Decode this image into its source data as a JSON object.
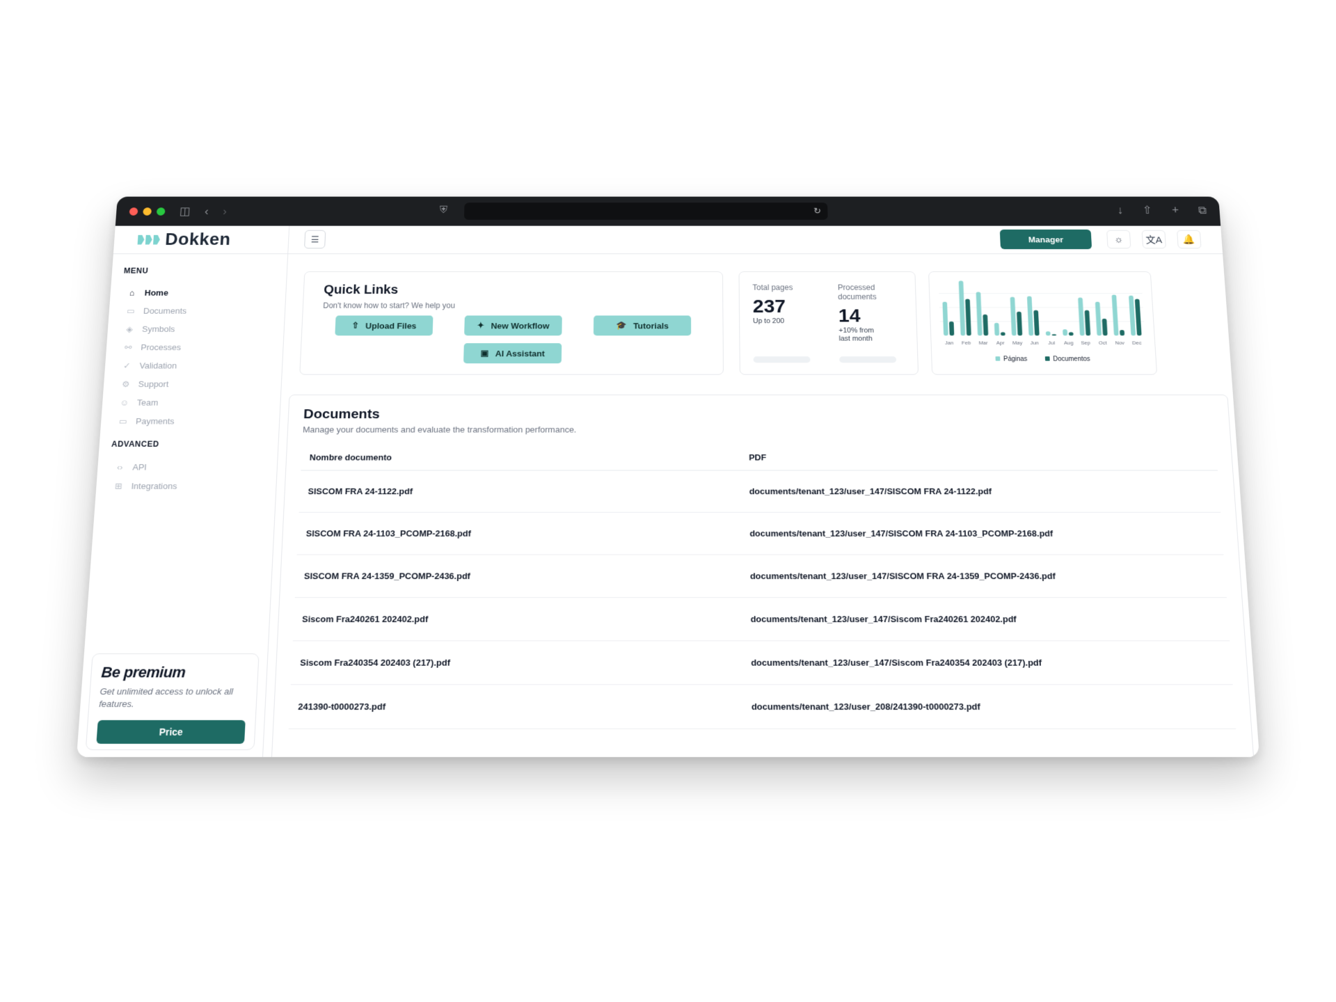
{
  "app": {
    "name": "Dokken"
  },
  "sidebar": {
    "menu_title": "MENU",
    "items": [
      {
        "label": "Home",
        "icon": "home-icon",
        "active": true
      },
      {
        "label": "Documents",
        "icon": "folder-icon"
      },
      {
        "label": "Symbols",
        "icon": "symbols-icon"
      },
      {
        "label": "Processes",
        "icon": "processes-icon"
      },
      {
        "label": "Validation",
        "icon": "check-icon"
      },
      {
        "label": "Support",
        "icon": "gear-icon"
      },
      {
        "label": "Team",
        "icon": "user-icon"
      },
      {
        "label": "Payments",
        "icon": "card-icon"
      }
    ],
    "advanced_title": "ADVANCED",
    "advanced_items": [
      {
        "label": "API",
        "icon": "code-icon"
      },
      {
        "label": "Integrations",
        "icon": "integrations-icon"
      }
    ],
    "premium": {
      "title": "Be premium",
      "text": "Get unlimited access to unlock all features.",
      "button": "Price"
    }
  },
  "topbar": {
    "manager_label": "Manager"
  },
  "quick_links": {
    "title": "Quick Links",
    "subtitle": "Don't know how to start? We help you",
    "buttons": [
      {
        "label": "Upload Files",
        "icon": "upload-icon"
      },
      {
        "label": "New Workflow",
        "icon": "workflow-icon"
      },
      {
        "label": "Tutorials",
        "icon": "graduation-cap-icon"
      },
      {
        "label": "AI Assistant",
        "icon": "robot-icon"
      }
    ]
  },
  "stats": {
    "total_pages": {
      "label": "Total pages",
      "value": "237",
      "note": "Up to 200"
    },
    "processed": {
      "label_line1": "Processed",
      "label_line2": "documents",
      "value": "14",
      "note_line1": "+10% from",
      "note_line2": "last month"
    }
  },
  "chart_data": {
    "type": "bar",
    "categories": [
      "Jan",
      "Feb",
      "Mar",
      "Apr",
      "May",
      "Jun",
      "Jul",
      "Aug",
      "Sep",
      "Oct",
      "Nov",
      "Dec"
    ],
    "series": [
      {
        "name": "Páginas",
        "color": "#8fd6d2",
        "values": [
          48,
          78,
          62,
          18,
          55,
          56,
          6,
          9,
          54,
          48,
          58,
          57
        ]
      },
      {
        "name": "Documentos",
        "color": "#1e6b64",
        "values": [
          20,
          52,
          30,
          5,
          34,
          36,
          2,
          5,
          36,
          24,
          8,
          52
        ]
      }
    ],
    "ylim": [
      0,
      80
    ],
    "legend": "bottom"
  },
  "documents": {
    "title": "Documents",
    "subtitle": "Manage your documents and evaluate the transformation performance.",
    "columns": [
      "Nombre documento",
      "PDF"
    ],
    "rows": [
      [
        "SISCOM FRA 24-1122.pdf",
        "documents/tenant_123/user_147/SISCOM FRA 24-1122.pdf"
      ],
      [
        "SISCOM FRA 24-1103_PCOMP-2168.pdf",
        "documents/tenant_123/user_147/SISCOM FRA 24-1103_PCOMP-2168.pdf"
      ],
      [
        "SISCOM FRA 24-1359_PCOMP-2436.pdf",
        "documents/tenant_123/user_147/SISCOM FRA 24-1359_PCOMP-2436.pdf"
      ],
      [
        "Siscom Fra240261 202402.pdf",
        "documents/tenant_123/user_147/Siscom Fra240261 202402.pdf"
      ],
      [
        "Siscom Fra240354 202403 (217).pdf",
        "documents/tenant_123/user_147/Siscom Fra240354 202403 (217).pdf"
      ],
      [
        "241390-t0000273.pdf",
        "documents/tenant_123/user_208/241390-t0000273.pdf"
      ]
    ]
  }
}
